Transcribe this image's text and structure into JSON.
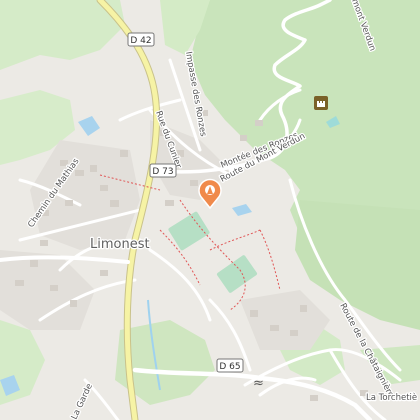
{
  "map": {
    "town_label": "Limonest",
    "road_shields": [
      "D 42",
      "D 73",
      "D 65"
    ],
    "street_labels": [
      "Rue du Cunier",
      "Impasse des Ronzes",
      "Montée des Ronzes",
      "Route du Mont Verdun",
      "Chemin du Mathias",
      "Route de la Châtaignière",
      "mont Verdun",
      "La Garde",
      "La Torchetiè"
    ],
    "marker": {
      "icon": "pin-marker-icon",
      "color": "#f08a4b"
    },
    "poi": {
      "icon": "castle-icon"
    },
    "colors": {
      "background": "#eceae5",
      "forest": "#c7e3b9",
      "forest_light": "#dcefd2",
      "water": "#a8d3ee",
      "road_major": "#f6f3a5",
      "road_minor": "#ffffff",
      "sport": "#b6dfc5"
    }
  }
}
